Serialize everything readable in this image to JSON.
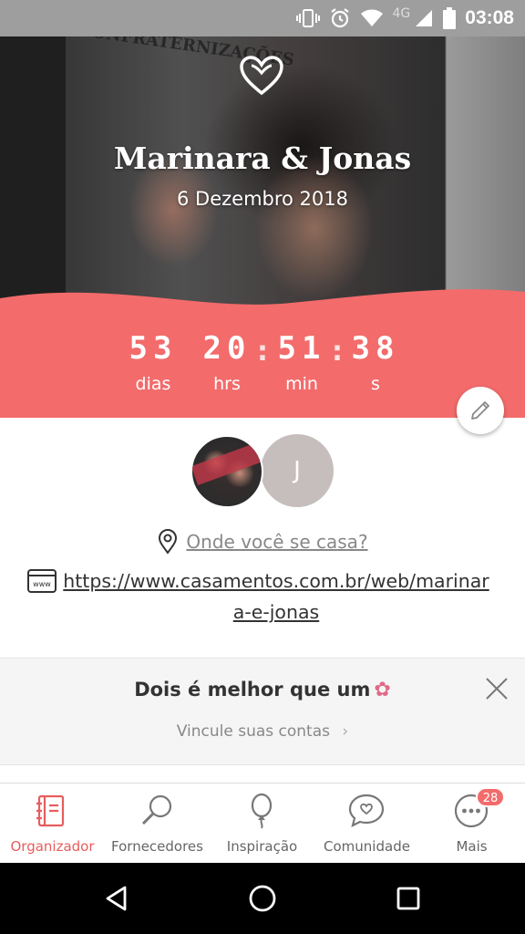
{
  "status_bar": {
    "network": "4G",
    "time": "03:08",
    "icons": [
      "vibrate-icon",
      "alarm-icon",
      "wifi-icon",
      "signal-icon",
      "battery-icon"
    ]
  },
  "hero": {
    "couple_name": "Marinara & Jonas",
    "wedding_date": "6 Dezembro 2018",
    "sign_text": "CONFRATERNIZAÇÕES",
    "countdown": [
      {
        "value": "53",
        "label": "dias"
      },
      {
        "value": "20",
        "label": "hrs"
      },
      {
        "value": "51",
        "label": "min"
      },
      {
        "value": "38",
        "label": "s"
      }
    ],
    "accent_color": "#f36b6b"
  },
  "profile": {
    "partner_initial": "J",
    "venue_prompt": "Onde você se casa?",
    "website_url": "https://www.casamentos.com.br/web/marinara-e-jonas"
  },
  "promo": {
    "title": "Dois é melhor que um",
    "link": "Vincule suas contas"
  },
  "bottom_nav": {
    "items": [
      {
        "label": "Organizador",
        "icon": "planner-icon",
        "active": true
      },
      {
        "label": "Fornecedores",
        "icon": "search-icon",
        "active": false
      },
      {
        "label": "Inspiração",
        "icon": "balloon-icon",
        "active": false
      },
      {
        "label": "Comunidade",
        "icon": "chat-heart-icon",
        "active": false
      },
      {
        "label": "Mais",
        "icon": "more-icon",
        "active": false,
        "badge": "28"
      }
    ]
  },
  "system_nav": [
    "back-icon",
    "home-icon",
    "recents-icon"
  ]
}
